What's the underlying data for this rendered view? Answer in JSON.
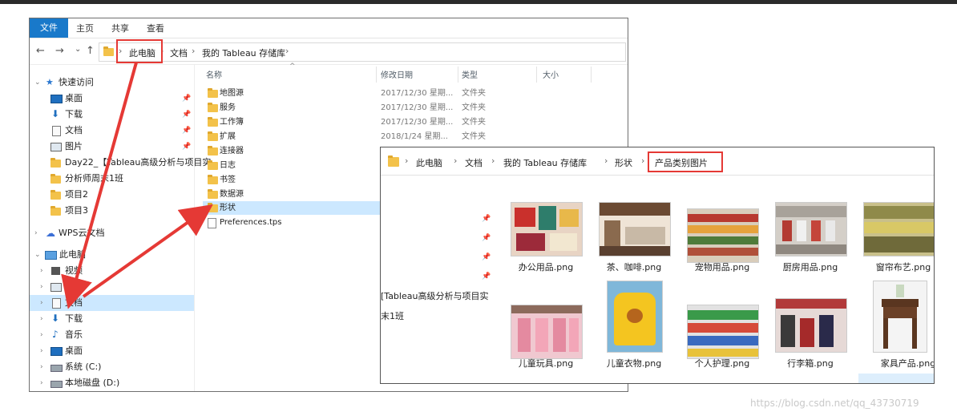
{
  "ribbon": {
    "tabs": [
      "文件",
      "主页",
      "共享",
      "查看"
    ]
  },
  "explorer1": {
    "nav": {
      "back": "←",
      "forward": "→",
      "recent": "⌄",
      "up": "↑"
    },
    "breadcrumb": [
      "此电脑",
      "文档",
      "我的 Tableau 存储库"
    ],
    "nav_items": {
      "quick_access": "快速访问",
      "desktop": "桌面",
      "downloads": "下载",
      "documents": "文档",
      "pictures": "图片",
      "day22": "Day22_【Tableau高级分析与项目实",
      "class": "分析师周末1班",
      "project2": "项目2",
      "project3": "项目3",
      "wps": "WPS云文档",
      "this_pc": "此电脑",
      "videos": "视频",
      "pictures2": "图片",
      "documents2": "文档",
      "downloads2": "下载",
      "music": "音乐",
      "desktop2": "桌面",
      "system_c": "系统 (C:)",
      "local_d": "本地磁盘 (D:)"
    },
    "columns": {
      "name": "名称",
      "date": "修改日期",
      "type": "类型",
      "size": "大小"
    },
    "files": [
      {
        "name": "地图源",
        "date": "2017/12/30 星期...",
        "type": "文件夹"
      },
      {
        "name": "服务",
        "date": "2017/12/30 星期...",
        "type": "文件夹"
      },
      {
        "name": "工作簿",
        "date": "2017/12/30 星期...",
        "type": "文件夹"
      },
      {
        "name": "扩展",
        "date": "2018/1/24 星期...",
        "type": "文件夹"
      },
      {
        "name": "连接器",
        "date": "",
        "type": ""
      },
      {
        "name": "日志",
        "date": "",
        "type": ""
      },
      {
        "name": "书签",
        "date": "",
        "type": ""
      },
      {
        "name": "数据源",
        "date": "",
        "type": ""
      },
      {
        "name": "形状",
        "date": "",
        "type": ""
      },
      {
        "name": "Preferences.tps",
        "date": "",
        "type": ""
      }
    ]
  },
  "explorer2": {
    "breadcrumb": [
      "此电脑",
      "文档",
      "我的 Tableau 存储库",
      "形状",
      "产品类别图片"
    ],
    "left_text": [
      "[Tableau高级分析与项目实",
      "末1班"
    ],
    "images": [
      {
        "name": "办公用品.png"
      },
      {
        "name": "茶、咖啡.png"
      },
      {
        "name": "宠物用品.png"
      },
      {
        "name": "厨房用品.png"
      },
      {
        "name": "窗帘布艺.png"
      },
      {
        "name": "儿童玩具.png"
      },
      {
        "name": "儿童衣物.png"
      },
      {
        "name": "个人护理.png"
      },
      {
        "name": "行李箱.png"
      },
      {
        "name": "家具产品.png"
      }
    ]
  },
  "glyphs": {
    "pin": "📌",
    "expand": "›",
    "collapse": "⌄",
    "sep": "›",
    "sort": "^"
  },
  "watermark": "https://blog.csdn.net/qq_43730719"
}
